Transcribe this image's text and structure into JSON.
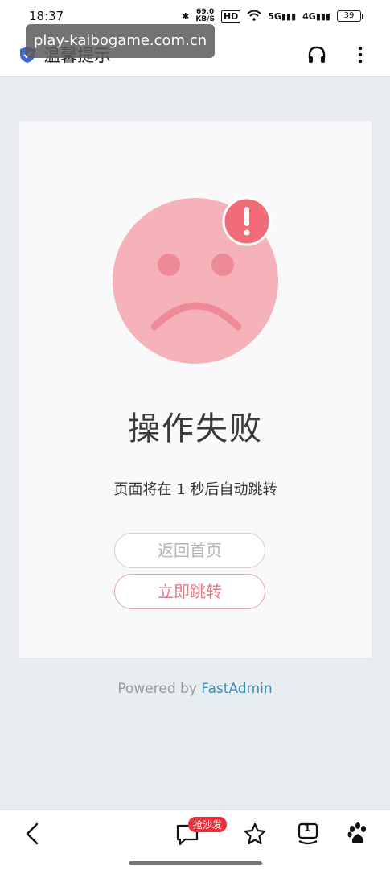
{
  "status_bar": {
    "time": "18:37",
    "net_speed_value": "69.0",
    "net_speed_unit": "KB/S",
    "hd_label": "HD",
    "sig1_label": "5G",
    "sig2_label": "4G",
    "battery": "39"
  },
  "header": {
    "title": "温馨提示"
  },
  "url_toast": "play-kaibogame.com.cn",
  "card": {
    "title": "操作失败",
    "subtitle": "页面将在 1 秒后自动跳转",
    "back_button": "返回首页",
    "jump_button": "立即跳转"
  },
  "footer": {
    "powered_prefix": "Powered by ",
    "brand": "FastAdmin"
  },
  "bottom_nav": {
    "comment_badge": "抢沙发",
    "tab_count": "1"
  },
  "colors": {
    "face": "#f6b2b9",
    "face_features": "#ee8a96",
    "alert": "#ef6c78",
    "brand_link": "#3d8fb0"
  }
}
